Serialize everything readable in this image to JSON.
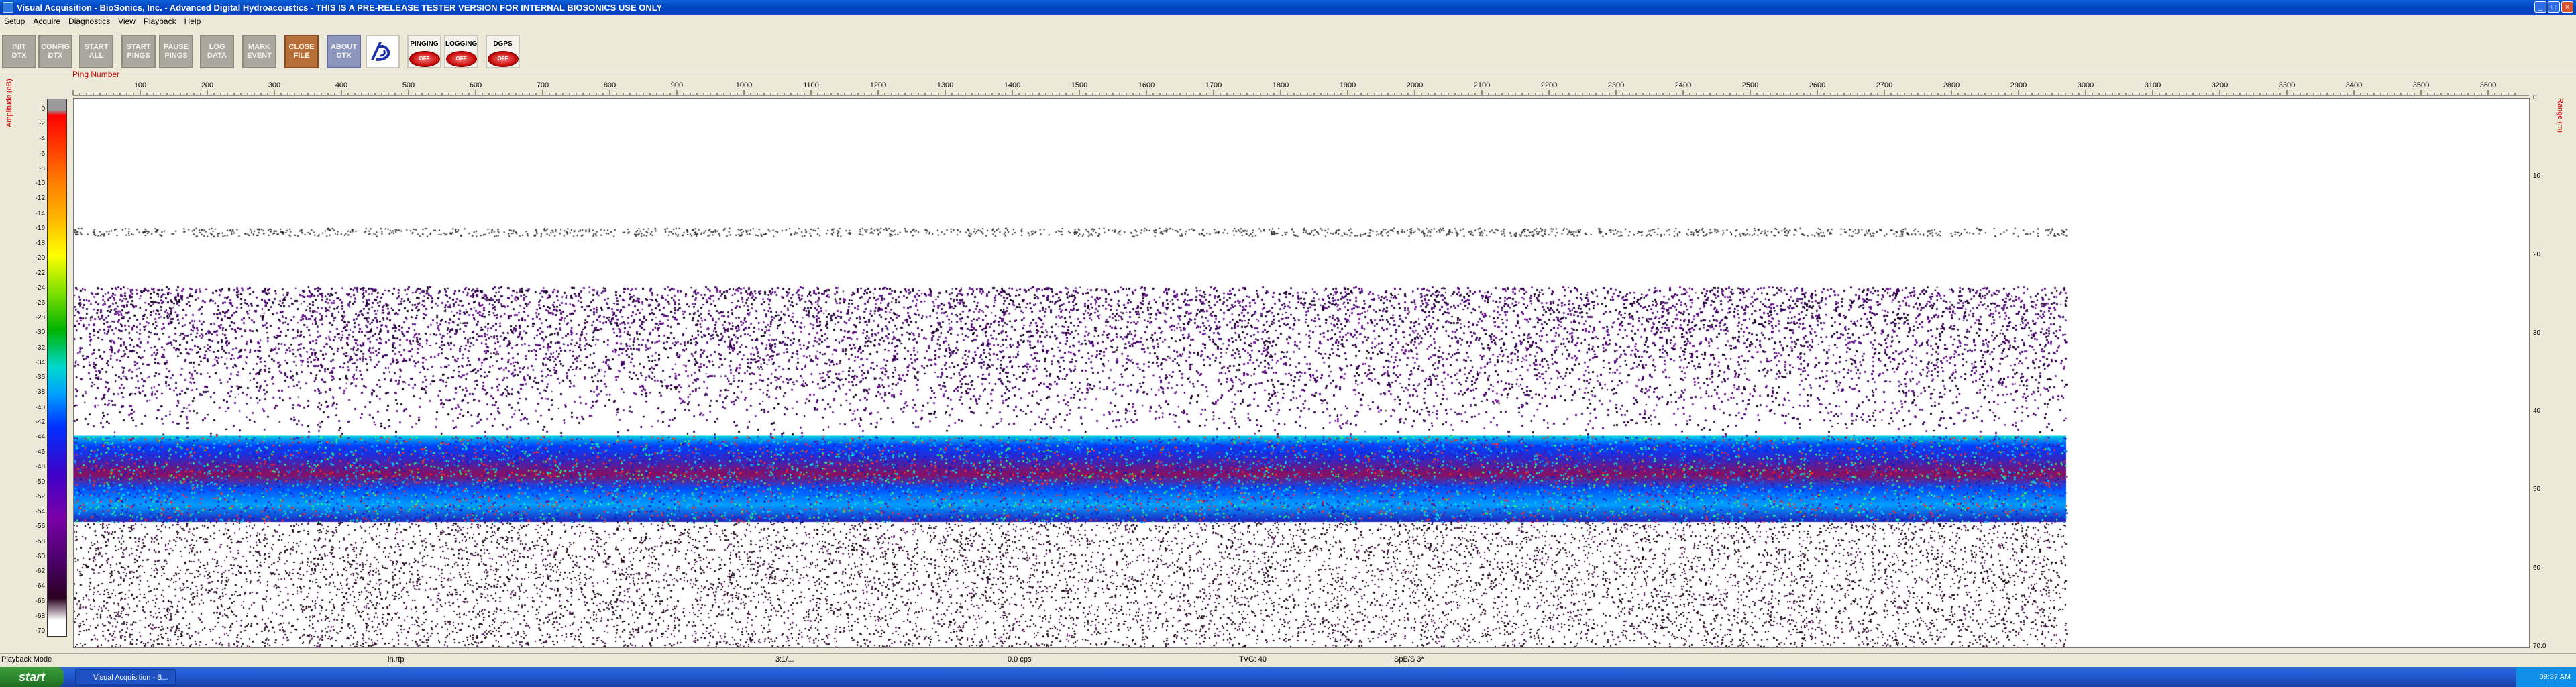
{
  "window": {
    "title": "Visual Acquisition  -  BioSonics, Inc.  -  Advanced Digital Hydroacoustics  -  THIS IS A PRE-RELEASE TESTER VERSION FOR INTERNAL BIOSONICS USE ONLY",
    "minimize": "_",
    "maximize": "□",
    "close": "×"
  },
  "menu": [
    "Setup",
    "Acquire",
    "Diagnostics",
    "View",
    "Playback",
    "Help"
  ],
  "toolbar": {
    "buttons": [
      [
        "INIT",
        "DTX"
      ],
      [
        "CONFIG",
        "DTX"
      ],
      [
        "START",
        "ALL"
      ],
      [
        "START",
        "PINGS"
      ],
      [
        "PAUSE",
        "PINGS"
      ],
      [
        "LOG",
        "DATA"
      ],
      [
        "MARK",
        "EVENT"
      ],
      [
        "CLOSE",
        "FILE"
      ],
      [
        "ABOUT",
        "DTX"
      ]
    ],
    "status": [
      {
        "label": "PINGING",
        "state": "OFF"
      },
      {
        "label": "LOGGING",
        "state": "OFF"
      },
      {
        "label": "DGPS",
        "state": "OFF"
      }
    ]
  },
  "echogram": {
    "ping_label": "Ping Number",
    "amplitude_label": "Amplitude (dB)",
    "range_label": "Range (m)",
    "ping_ticks": [
      "100",
      "200",
      "300",
      "400",
      "500",
      "600",
      "700",
      "800",
      "900",
      "1000",
      "1100",
      "1200",
      "1300",
      "1400",
      "1500",
      "1600",
      "1700",
      "1800",
      "1900",
      "2000",
      "2100",
      "2200",
      "2300",
      "2400",
      "2500",
      "2600",
      "2700",
      "2800",
      "2900",
      "3000",
      "3100",
      "3200",
      "3300",
      "3400",
      "3500",
      "3600"
    ],
    "amplitude_ticks": [
      "0",
      "-2",
      "-4",
      "-6",
      "-8",
      "-10",
      "-12",
      "-14",
      "-16",
      "-18",
      "-20",
      "-22",
      "-24",
      "-26",
      "-28",
      "-30",
      "-32",
      "-34",
      "-36",
      "-38",
      "-40",
      "-42",
      "-44",
      "-46",
      "-48",
      "-50",
      "-52",
      "-54",
      "-56",
      "-58",
      "-60",
      "-62",
      "-64",
      "-66",
      "-68",
      "-70"
    ],
    "range_ticks": [
      "0",
      "10",
      "20",
      "30",
      "40",
      "50",
      "60",
      "70.0"
    ],
    "pings_displayed": 2970,
    "max_range_m": 70.0,
    "surface_noise_depth_m": 17,
    "scatter_layer_top_m": 24,
    "strong_band_top_m": 43,
    "strong_band_bottom_m": 54
  },
  "statusbar": {
    "mode": "Playback Mode",
    "file": "in.rtp",
    "time": "3:1/...",
    "size": "0.0 cps",
    "tvg": "TVG: 40",
    "spb": "SpB/S 3*"
  },
  "taskbar": {
    "start": "start",
    "item": "Visual Acquisition  -  B...",
    "clock": "09:37 AM"
  }
}
